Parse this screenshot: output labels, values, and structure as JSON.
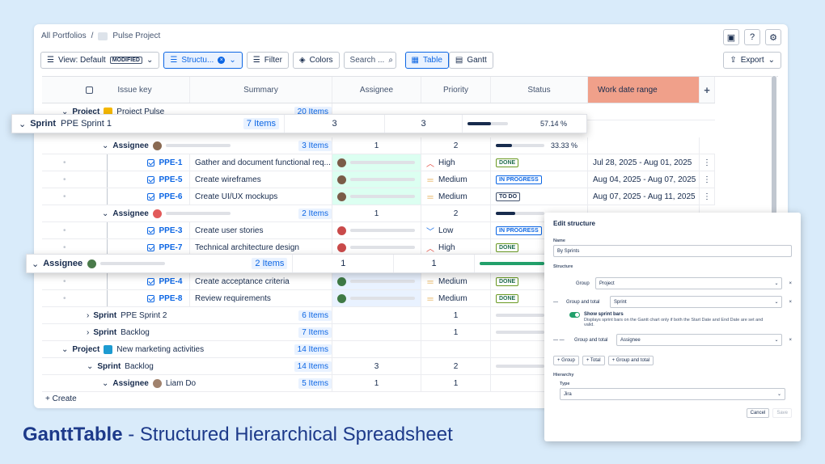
{
  "breadcrumb": {
    "root": "All Portfolios",
    "sep": "/",
    "project": "Pulse Project"
  },
  "top_icons": [
    "screen-icon",
    "help-icon",
    "gear-icon"
  ],
  "toolbar": {
    "view": "View: Default",
    "modified": "MODIFIED",
    "structure": "Structu...",
    "filter": "Filter",
    "colors": "Colors",
    "search_placeholder": "Search ...",
    "table": "Table",
    "gantt": "Gantt",
    "export": "Export"
  },
  "columns": [
    "Issue key",
    "Summary",
    "Assignee",
    "Priority",
    "Status",
    "Work date range",
    "+"
  ],
  "rows": [
    {
      "type": "project",
      "label": "Project",
      "name": "Project Pulse",
      "count": "20 Items"
    },
    {
      "type": "group",
      "label": "Assignee",
      "count": "3 Items",
      "assignee": "1",
      "priority": "2",
      "progress": "33.33 %",
      "pct": 33.33
    },
    {
      "type": "issue",
      "key": "PPE-1",
      "summary": "Gather and document functional req...",
      "priority": "High",
      "status": "DONE",
      "dates": "Jul 28, 2025 - Aug 01, 2025"
    },
    {
      "type": "issue",
      "key": "PPE-5",
      "summary": "Create wireframes",
      "priority": "Medium",
      "status": "IN PROGRESS",
      "dates": "Aug 04, 2025 - Aug 07, 2025"
    },
    {
      "type": "issue",
      "key": "PPE-6",
      "summary": "Create UI/UX mockups",
      "priority": "Medium",
      "status": "TO DO",
      "dates": "Aug 07, 2025 - Aug 11, 2025"
    },
    {
      "type": "group",
      "label": "Assignee",
      "count": "2 Items",
      "assignee": "1",
      "priority": "2",
      "progress": "",
      "pct": 40
    },
    {
      "type": "issue",
      "key": "PPE-3",
      "summary": "Create user stories",
      "priority": "Low",
      "status": "IN PROGRESS",
      "dates": ""
    },
    {
      "type": "issue",
      "key": "PPE-7",
      "summary": "Technical architecture design",
      "priority": "High",
      "status": "DONE",
      "dates": ""
    },
    {
      "type": "blank"
    },
    {
      "type": "issue",
      "key": "PPE-4",
      "summary": "Create acceptance criteria",
      "priority": "Medium",
      "status": "DONE",
      "dates": ""
    },
    {
      "type": "issue",
      "key": "PPE-8",
      "summary": "Review requirements",
      "priority": "Medium",
      "status": "DONE",
      "dates": ""
    },
    {
      "type": "sprint",
      "label": "Sprint",
      "name": "PPE Sprint 2",
      "count": "6 Items",
      "priority": "1"
    },
    {
      "type": "sprint",
      "label": "Sprint",
      "name": "Backlog",
      "count": "7 Items",
      "priority": "1"
    },
    {
      "type": "project",
      "label": "Project",
      "name": "New marketing activities",
      "count": "14 Items"
    },
    {
      "type": "sprint2",
      "label": "Sprint",
      "name": "Backlog",
      "count": "14 Items",
      "assignee": "3",
      "priority": "2"
    },
    {
      "type": "assignee2",
      "label": "Assignee",
      "name": "Liam Do",
      "count": "5 Items",
      "assignee": "1",
      "priority": "1"
    }
  ],
  "float_sprint": {
    "label": "Sprint",
    "name": "PPE Sprint 1",
    "count": "7 Items",
    "assignee": "3",
    "priority": "3",
    "progress": "57.14 %",
    "pct": 57.14
  },
  "float_assignee": {
    "label": "Assignee",
    "count": "2 Items",
    "assignee": "1",
    "priority": "1"
  },
  "create": "+ Create",
  "panel": {
    "title": "Edit structure",
    "name_label": "Name",
    "name_value": "By Sprints",
    "structure_label": "Structure",
    "r1_label": "Group",
    "r1_value": "Project",
    "r2_label": "Group and total",
    "r2_value": "Sprint",
    "sprint_bars_title": "Show sprint bars",
    "sprint_bars_desc": "Displays sprint bars on the Gantt chart only if both the Start Date and End Date are set and valid.",
    "r3_label": "Group and total",
    "r3_value": "Assignee",
    "add_group": "+ Group",
    "add_total": "+ Total",
    "add_gt": "+ Group and total",
    "hierarchy_label": "Hierarchy",
    "type_label": "Type",
    "type_value": "Jira",
    "cancel": "Cancel",
    "save": "Save"
  },
  "footer": {
    "bold": "GanttTable",
    "rest": " - Structured Hierarchical Spreadsheet"
  }
}
